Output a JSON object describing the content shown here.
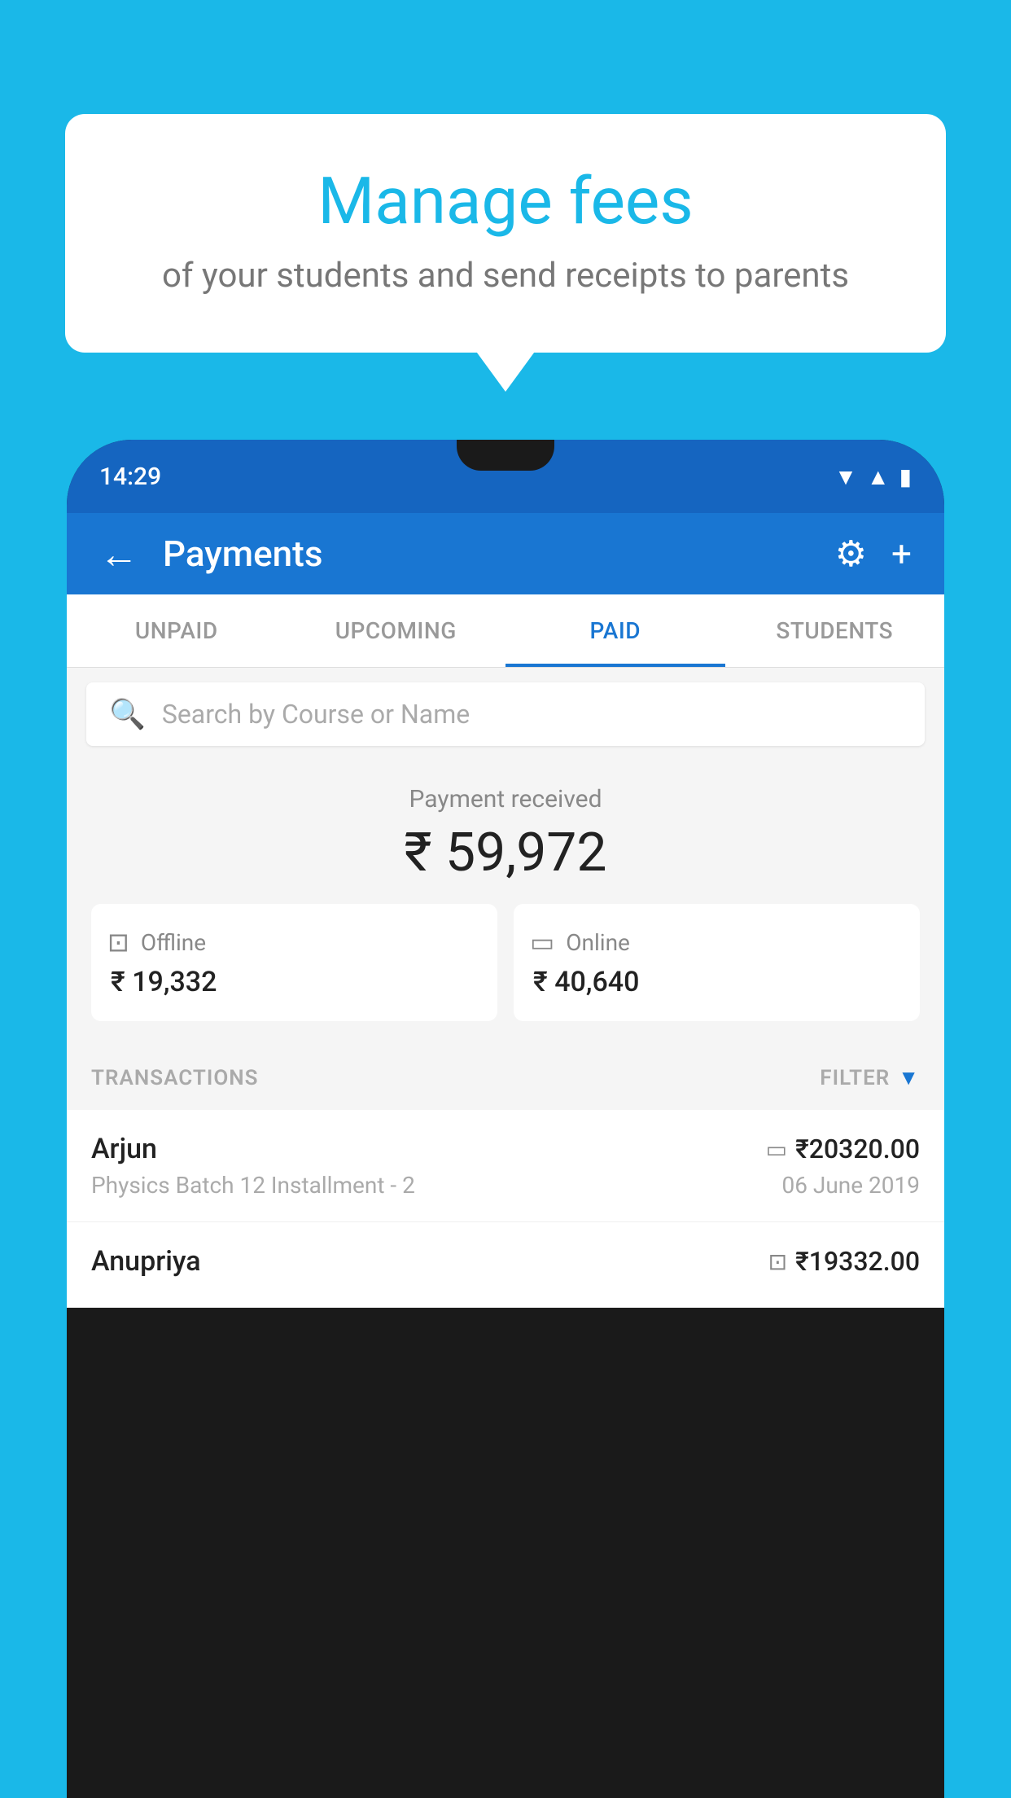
{
  "background_color": "#1ab8e8",
  "bubble": {
    "title": "Manage fees",
    "subtitle": "of your students and send receipts to parents"
  },
  "status_bar": {
    "time": "14:29",
    "icons": [
      "wifi",
      "signal",
      "battery"
    ]
  },
  "header": {
    "title": "Payments",
    "back_label": "←",
    "settings_label": "⚙",
    "add_label": "+"
  },
  "tabs": [
    {
      "label": "UNPAID",
      "active": false
    },
    {
      "label": "UPCOMING",
      "active": false
    },
    {
      "label": "PAID",
      "active": true
    },
    {
      "label": "STUDENTS",
      "active": false
    }
  ],
  "search": {
    "placeholder": "Search by Course or Name"
  },
  "payment_summary": {
    "label": "Payment received",
    "total": "₹ 59,972",
    "offline": {
      "label": "Offline",
      "amount": "₹ 19,332"
    },
    "online": {
      "label": "Online",
      "amount": "₹ 40,640"
    }
  },
  "transactions": {
    "header_label": "TRANSACTIONS",
    "filter_label": "FILTER",
    "rows": [
      {
        "name": "Arjun",
        "course": "Physics Batch 12 Installment - 2",
        "amount": "₹20320.00",
        "date": "06 June 2019",
        "type": "online"
      },
      {
        "name": "Anupriya",
        "course": "",
        "amount": "₹19332.00",
        "date": "",
        "type": "offline"
      }
    ]
  }
}
